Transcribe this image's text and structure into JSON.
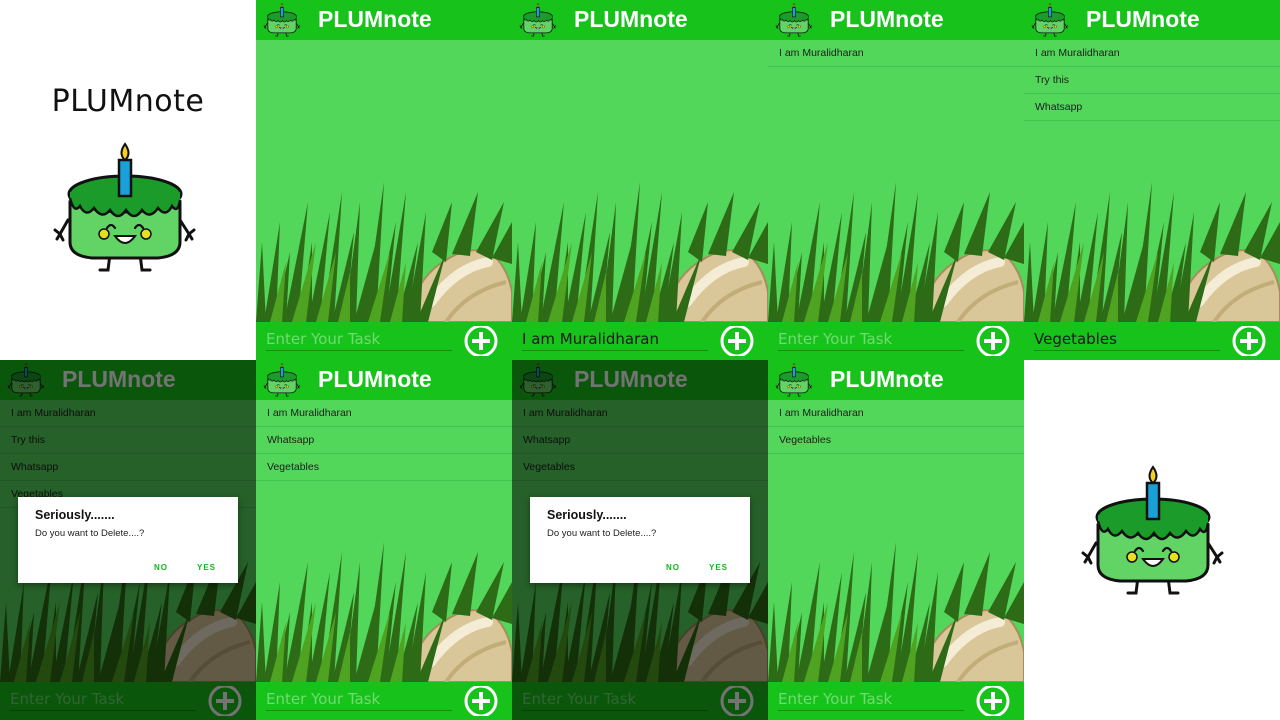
{
  "app": {
    "name": "PLUMnote"
  },
  "input": {
    "placeholder": "Enter Your Task"
  },
  "screens": [
    {
      "id": "splash-1",
      "title": "PLUMnote"
    },
    {
      "id": "empty",
      "input_value": "",
      "items": []
    },
    {
      "id": "typing",
      "input_value": "I am Muralidharan",
      "items": []
    },
    {
      "id": "one-item",
      "input_value": "",
      "items": [
        "I am Muralidharan"
      ]
    },
    {
      "id": "typing-vegetables",
      "input_value": "Vegetables",
      "items": [
        "I am Muralidharan",
        "Try this",
        "Whatsapp"
      ]
    },
    {
      "id": "delete-dialog-1",
      "input_value": "",
      "items": [
        "I am Muralidharan",
        "Try this",
        "Whatsapp",
        "Vegetables"
      ],
      "dialog": {
        "title": "Seriously.......",
        "message": "Do you want to Delete....?",
        "no": "NO",
        "yes": "YES"
      }
    },
    {
      "id": "after-delete-1",
      "input_value": "",
      "items": [
        "I am Muralidharan",
        "Whatsapp",
        "Vegetables"
      ]
    },
    {
      "id": "delete-dialog-2",
      "input_value": "",
      "items": [
        "I am Muralidharan",
        "Whatsapp",
        "Vegetables"
      ],
      "dialog": {
        "title": "Seriously.......",
        "message": "Do you want to Delete....?",
        "no": "NO",
        "yes": "YES"
      }
    },
    {
      "id": "after-delete-2",
      "input_value": "",
      "items": [
        "I am Muralidharan",
        "Vegetables"
      ]
    },
    {
      "id": "splash-2"
    }
  ],
  "colors": {
    "appbar": "#17c21a",
    "content": "#53d75a",
    "accent": "#17b31a"
  },
  "icons": {
    "add": "plus-circle-icon",
    "logo": "cake-mascot-icon"
  }
}
